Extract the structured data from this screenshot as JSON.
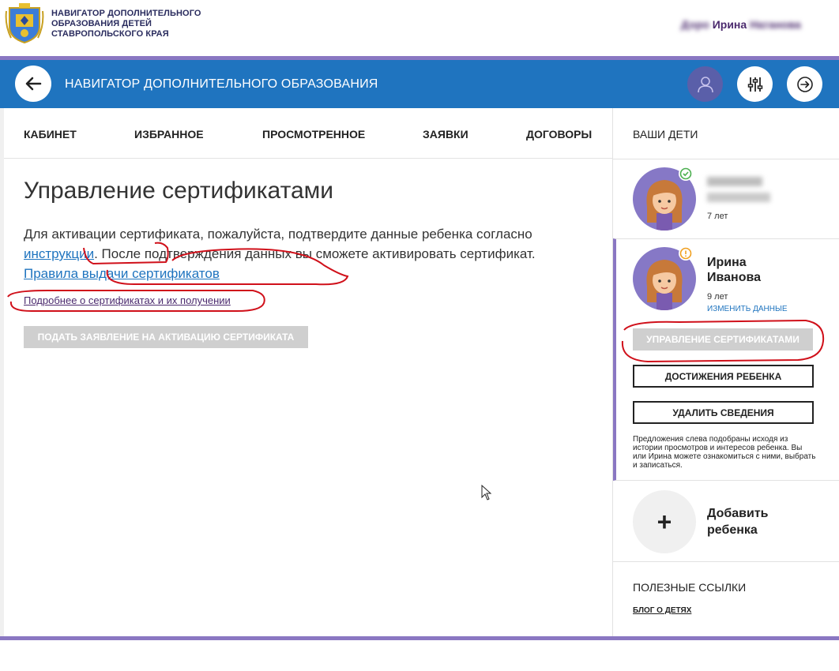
{
  "header": {
    "site_title_lines": [
      "НАВИГАТОР ДОПОЛНИТЕЛЬНОГО",
      "ОБРАЗОВАНИЯ ДЕТЕЙ",
      "СТАВРОПОЛЬСКОГО КРАЯ"
    ],
    "user_name_blurred_left": "Д",
    "user_name_visible": "Ирина",
    "user_name_blurred_right": "На"
  },
  "bluebar": {
    "title": "НАВИГАТОР ДОПОЛНИТЕЛЬНОГО ОБРАЗОВАНИЯ"
  },
  "nav": {
    "items": [
      "КАБИНЕТ",
      "ИЗБРАННОЕ",
      "ПРОСМОТРЕННОЕ",
      "ЗАЯВКИ",
      "ДОГОВОРЫ"
    ]
  },
  "main": {
    "title": "Управление сертификатами",
    "desc_part1": "Для активации сертификата, пожалуйста, подтвердите данные ребенка согласно ",
    "desc_link1": "инструкции",
    "desc_part2": ". После подтверждения данных вы сможете активировать сертификат. ",
    "desc_link2": "Правила выдачи сертификатов",
    "more_link": "Подробнее о сертификатах и их получении",
    "apply_button": "ПОДАТЬ ЗАЯВЛЕНИЕ НА АКТИВАЦИЮ СЕРТИФИКАТА"
  },
  "sidebar": {
    "kids_header": "ВАШИ ДЕТИ",
    "children": [
      {
        "name_line1": "",
        "name_line2": "",
        "age": "7 лет",
        "status": "confirmed",
        "status_color": "#4caf50"
      },
      {
        "name_line1": "Ирина",
        "name_line2": "Иванова",
        "age": "9 лет",
        "edit_label": "ИЗМЕНИТЬ ДАННЫЕ",
        "status": "warning",
        "status_color": "#f0a020"
      }
    ],
    "cert_button": "УПРАВЛЕНИЕ СЕРТИФИКАТАМИ",
    "achievements_button": "ДОСТИЖЕНИЯ РЕБЕНКА",
    "delete_button": "УДАЛИТЬ СВЕДЕНИЯ",
    "note": "Предложения слева подобраны исходя из истории просмотров и интересов ребенка. Вы или Ирина можете ознакомиться с ними, выбрать и записаться.",
    "add_child_icon": "+",
    "add_child_label": "Добавить ребенка",
    "links_header": "ПОЛЕЗНЫЕ ССЫЛКИ",
    "blog_link": "БЛОГ О ДЕТЯХ"
  },
  "colors": {
    "brand_blue": "#1f74bf",
    "accent_purple": "#8a77c2",
    "annotation_red": "#d0101a"
  }
}
